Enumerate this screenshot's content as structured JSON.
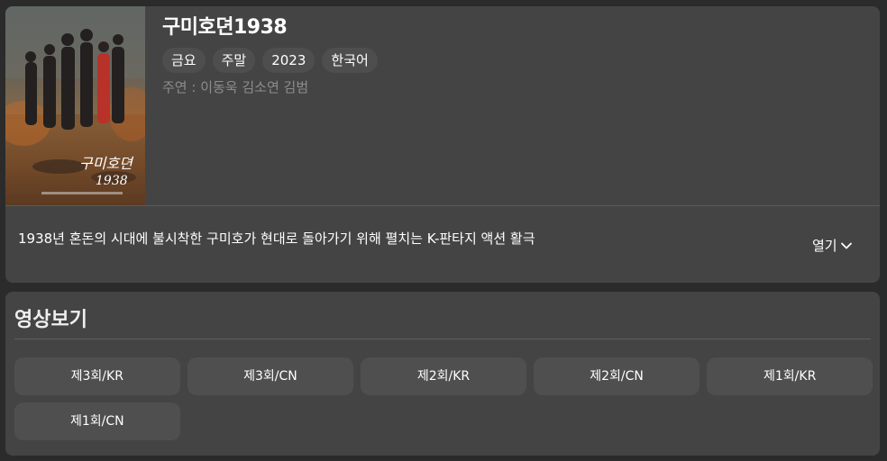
{
  "show": {
    "title": "구미호뎐1938",
    "tags": [
      "금요",
      "주말",
      "2023",
      "한국어"
    ],
    "cast": "주연 : 이동욱 김소연 김범",
    "poster_icon": "drama-poster-image",
    "poster_logo": "구미호뎐 1938",
    "synopsis": "1938년 혼돈의 시대에 불시착한 구미호가 현대로 돌아가기 위해 펼치는 K-판타지 액션 활극",
    "toggle_label": "열기",
    "toggle_icon": "chevron-down-icon"
  },
  "videos": {
    "section_title": "영상보기",
    "episodes": [
      "제3회/KR",
      "제3회/CN",
      "제2회/KR",
      "제2회/CN",
      "제1회/KR",
      "제1회/CN"
    ]
  },
  "colors": {
    "background": "#2b2b2b",
    "card": "#444444",
    "chip": "#4e4e4e",
    "episode_button": "#4f4f4f",
    "muted_text": "#8d8d8d"
  }
}
